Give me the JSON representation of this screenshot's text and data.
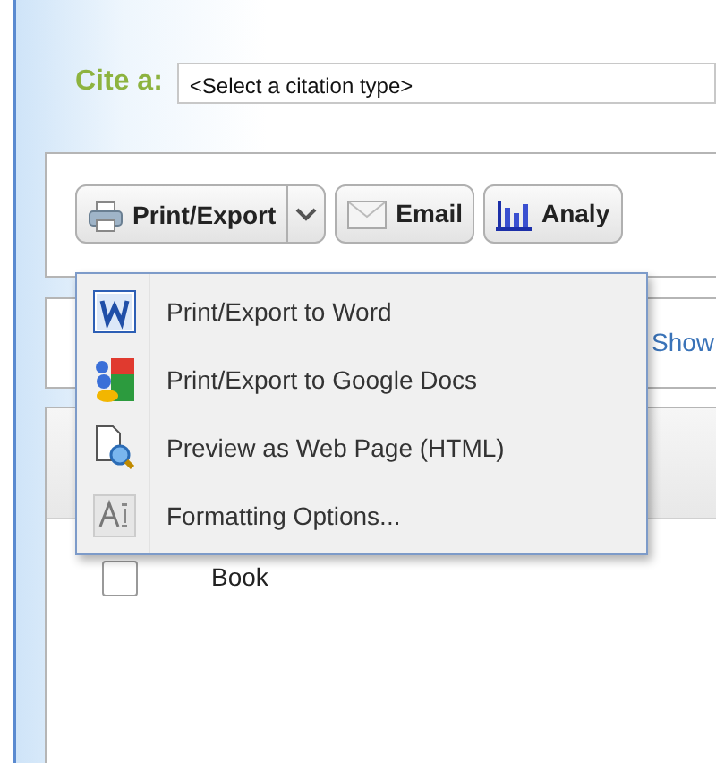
{
  "cite": {
    "label": "Cite a:",
    "select_value": "<Select a citation type>"
  },
  "toolbar": [
    {
      "kind": "split",
      "label": "Print/Export"
    },
    {
      "kind": "button",
      "label": "Email"
    },
    {
      "kind": "button",
      "label": "Analy"
    }
  ],
  "menu": {
    "expanded": true,
    "items": [
      {
        "label": "Print/Export to Word"
      },
      {
        "label": "Print/Export to Google Docs"
      },
      {
        "label": "Preview as Web Page (HTML)"
      },
      {
        "label": "Formatting Options..."
      }
    ]
  },
  "filter_bar": {
    "link": "Show"
  },
  "results": {
    "rows": [
      {
        "label": "Book",
        "checked": false
      }
    ]
  }
}
